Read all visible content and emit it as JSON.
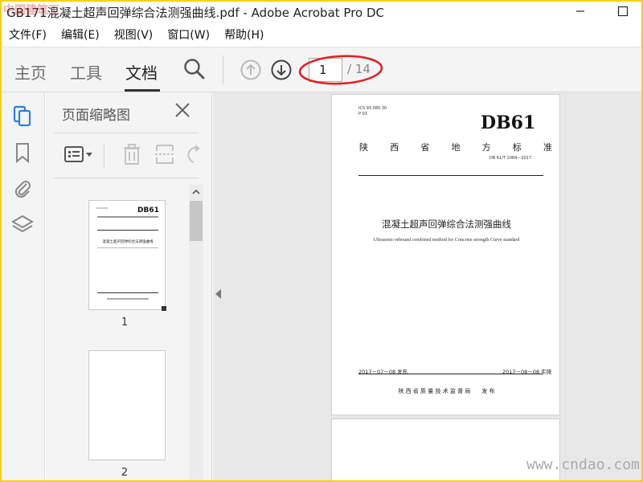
{
  "window": {
    "title": "GB171混凝土超声回弹综合法测强曲线.pdf - Adobe Acrobat Pro DC",
    "top_watermark": "中国建筑工"
  },
  "menu": [
    "文件(F)",
    "编辑(E)",
    "视图(V)",
    "窗口(W)",
    "帮助(H)"
  ],
  "toolbar": {
    "tabs": [
      "主页",
      "工具",
      "文档"
    ],
    "active_tab": "文档",
    "page_current": "1",
    "page_total": "/ 14"
  },
  "sidebar": {
    "icons": [
      "page-thumbnails-icon",
      "bookmark-icon",
      "attachment-icon",
      "layers-icon"
    ]
  },
  "thumbnail_panel": {
    "title": "页面缩略图",
    "thumbnails": [
      {
        "label": "1",
        "db": "DB61",
        "title": "混凝土超声回弹综合法测强曲线"
      },
      {
        "label": "2"
      }
    ]
  },
  "document": {
    "page1": {
      "ics": "ICS 93.080.30",
      "cls": "P 03",
      "code": "DB61",
      "province": [
        "陕",
        "西",
        "省",
        "地",
        "方",
        "标",
        "准"
      ],
      "std_number": "DB 61/T 1084—2017",
      "title": "混凝土超声回弹综合法测强曲线",
      "subtitle": "Ultrasonic-rebound combined method for Concrete strength Curve standard",
      "issue_date": "2017－07－08 发布",
      "impl_date": "2017－08－08 实施",
      "publisher": "陕 西 省 质 量 技 术 监 督 局　　发 布"
    }
  },
  "watermark": "www.cndao.com",
  "colors": {
    "frame": "#f5d000",
    "toolbar_bg": "#f4f4f4",
    "icon_blue": "#2c7be5",
    "ellipse_red": "#e02020"
  }
}
